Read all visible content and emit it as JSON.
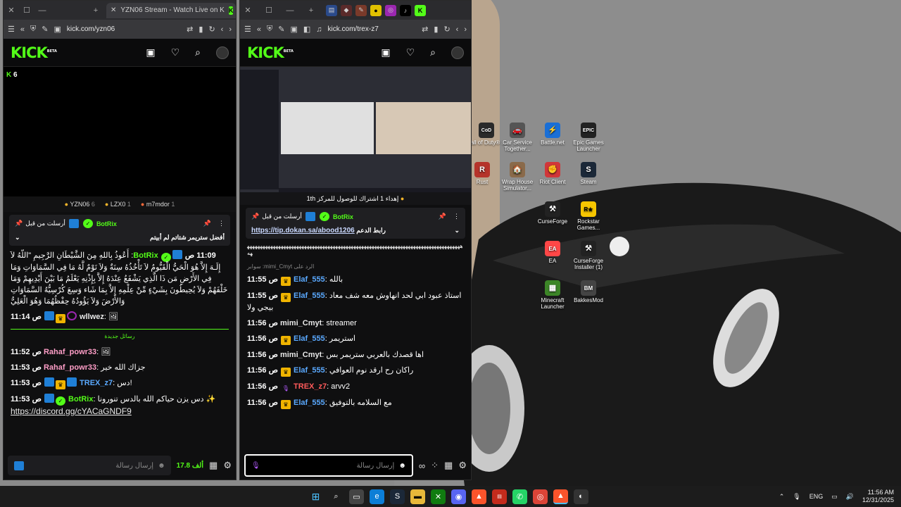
{
  "desktop": {
    "icons": [
      {
        "label": "Call of Duty® ...",
        "glyph": "CoD",
        "color": "#2a2a2a"
      },
      {
        "label": "Car Service Together...",
        "glyph": "🚗",
        "color": "#555"
      },
      {
        "label": "Battle.net",
        "glyph": "⚡",
        "color": "#1a6fd6"
      },
      {
        "label": "Epic Games Launcher",
        "glyph": "EPIC",
        "color": "#222"
      },
      {
        "label": "Rust",
        "glyph": "R",
        "color": "#b5332a"
      },
      {
        "label": "Wrap House Simulator...",
        "glyph": "🏠",
        "color": "#8a6a4a"
      },
      {
        "label": "Riot Client",
        "glyph": "✊",
        "color": "#d13639"
      },
      {
        "label": "Steam",
        "glyph": "S",
        "color": "#1b2838"
      },
      {
        "label": "CurseForge",
        "glyph": "⚒",
        "color": "#222"
      },
      {
        "label": "Rockstar Games...",
        "glyph": "R★",
        "color": "#f7c600"
      },
      {
        "label": "EA",
        "glyph": "EA",
        "color": "#ff4747"
      },
      {
        "label": "CurseForge Installer (1)",
        "glyph": "⚒",
        "color": "#222"
      },
      {
        "label": "Minecraft Launcher",
        "glyph": "▦",
        "color": "#3c8527"
      },
      {
        "label": "BakkesMod",
        "glyph": "BM",
        "color": "#444"
      }
    ]
  },
  "left_window": {
    "tab_title": "YZN06 Stream - Watch Live on K",
    "url": "kick.com/yzn06",
    "logo": "KICK",
    "logo_sup": "BETA",
    "viewer_count": "6",
    "gifters": [
      {
        "name": "YZN06",
        "count": "6"
      },
      {
        "name": "LZX0",
        "count": "1"
      },
      {
        "name": "m7mdor",
        "count": "1"
      }
    ],
    "pinned": {
      "header": "أرسلت من قبل",
      "user": "BotRix",
      "text": "أفضل ستريمر شتاتم لم أبيتم"
    },
    "messages": [
      {
        "time": "11:09 ص",
        "user": "BotRix",
        "user_class": "u-green",
        "badges": [
          "blue",
          "check"
        ],
        "text": "أَعُوذُ بِاللهِ مِنَ الشَّيْطَانِ الرَّجِيمِ \"اللّهُ لاَ إِلَـهَ إِلاَّ هُوَ الْحَيُّ الْقَيُّومُ لاَ تَأْخُذُهُ سِنَةٌ وَلاَ نَوْمٌ لَّهُ مَا فِي السَّمَاوَاتِ وَمَا فِي الأَرْضِ مَن ذَا الَّذِي يَشْفَعُ عِنْدَهُ إِلاَّ بِإِذْنِهِ يَعْلَمُ مَا بَيْنَ أَيْدِيهِمْ وَمَا خَلْفَهُمْ وَلاَ يُحِيطُونَ بِشَيْءٍ مِّنْ عِلْمِهِ إِلاَّ بِمَا شَاء وَسِعَ كُرْسِيُّهُ السَّمَاوَاتِ وَالأَرْضَ وَلاَ يَؤُودُهُ حِفْظُهُمَا وَهُوَ الْعَلِيُّ"
      },
      {
        "time": "11:14 ص",
        "user": "wllwez",
        "user_class": "u-white",
        "badges": [
          "blue",
          "crown",
          "circle"
        ],
        "text": "🖼"
      }
    ],
    "new_messages_label": "رسائل جديدة",
    "messages_new": [
      {
        "time": "11:52 ص",
        "user": "Rahaf_powr33",
        "user_class": "u-pink",
        "badges": [],
        "text": "🖼"
      },
      {
        "time": "11:53 ص",
        "user": "Rahaf_powr33",
        "user_class": "u-pink",
        "badges": [],
        "text": "جزاك الله خير"
      },
      {
        "time": "11:53 ص",
        "user": "TREX_z7",
        "user_class": "u-blue",
        "badges": [
          "blue",
          "crown",
          "blue"
        ],
        "text": "دس!"
      },
      {
        "time": "11:53 ص",
        "user": "BotRix",
        "user_class": "u-green",
        "badges": [
          "blue",
          "check"
        ],
        "text": "دس يزن حياكم الله بالدس تنورونا ✨"
      }
    ],
    "discord_link": "https://discord.gg/cYACaGNDF9",
    "input_placeholder": "إرسال رسالة",
    "kicks_amount": "17.8 ألف"
  },
  "right_window": {
    "url": "kick.com/trex-z7",
    "logo": "KICK",
    "logo_sup": "BETA",
    "banner": "إهداء 1 اشتراك للوصول للمركز 1",
    "banner_suffix": "th",
    "pinned": {
      "header": "أرسلت من قبل",
      "user": "BotRix",
      "label": "رابط الدعم",
      "link": "https://tip.dokan.sa/abood1206"
    },
    "spam_text": "ههههههههههههههههههههههههههههههههههههههههههههههههههههههههههههههههههههههههههههههههههههه",
    "reply_label": "الرد على mimi_Cmyt: سوابر",
    "messages": [
      {
        "time": "11:55 ص",
        "user": "Elaf_555",
        "user_class": "u-blue",
        "badges": [
          "crown"
        ],
        "text": "بالله"
      },
      {
        "time": "11:55 ص",
        "user": "Elaf_555",
        "user_class": "u-blue",
        "badges": [
          "crown"
        ],
        "text": "استاذ عبود ابي لحد انهاوش معه شف معاد بيجي ولا"
      },
      {
        "time": "11:56 ص",
        "user": "mimi_Cmyt",
        "user_class": "u-white",
        "badges": [],
        "text": "streamer"
      },
      {
        "time": "11:56 ص",
        "user": "Elaf_555",
        "user_class": "u-blue",
        "badges": [
          "crown"
        ],
        "text": "استريمر"
      },
      {
        "time": "11:56 ص",
        "user": "mimi_Cmyt",
        "user_class": "u-white",
        "badges": [],
        "text": "اها قصدك بالعربي ستريمر بس"
      },
      {
        "time": "11:56 ص",
        "user": "Elaf_555",
        "user_class": "u-blue",
        "badges": [
          "crown"
        ],
        "text": "راكان رح ارقد نوم العوافي"
      },
      {
        "time": "11:56 ص",
        "user": "TREX_z7",
        "user_class": "u-red",
        "badges": [
          "mic"
        ],
        "text": "arvv2"
      },
      {
        "time": "11:56 ص",
        "user": "Elaf_555",
        "user_class": "u-blue",
        "badges": [
          "crown"
        ],
        "text": "مع السلامه بالتوفيق"
      }
    ],
    "input_placeholder": "إرسال رسالة"
  },
  "taskbar": {
    "language": "ENG",
    "time": "11:56 AM",
    "date": "12/31/2025"
  },
  "colors": {
    "kick_green": "#53fc18",
    "window_bg": "#0f0f10",
    "taskbar_bg": "#1c1c1c"
  }
}
